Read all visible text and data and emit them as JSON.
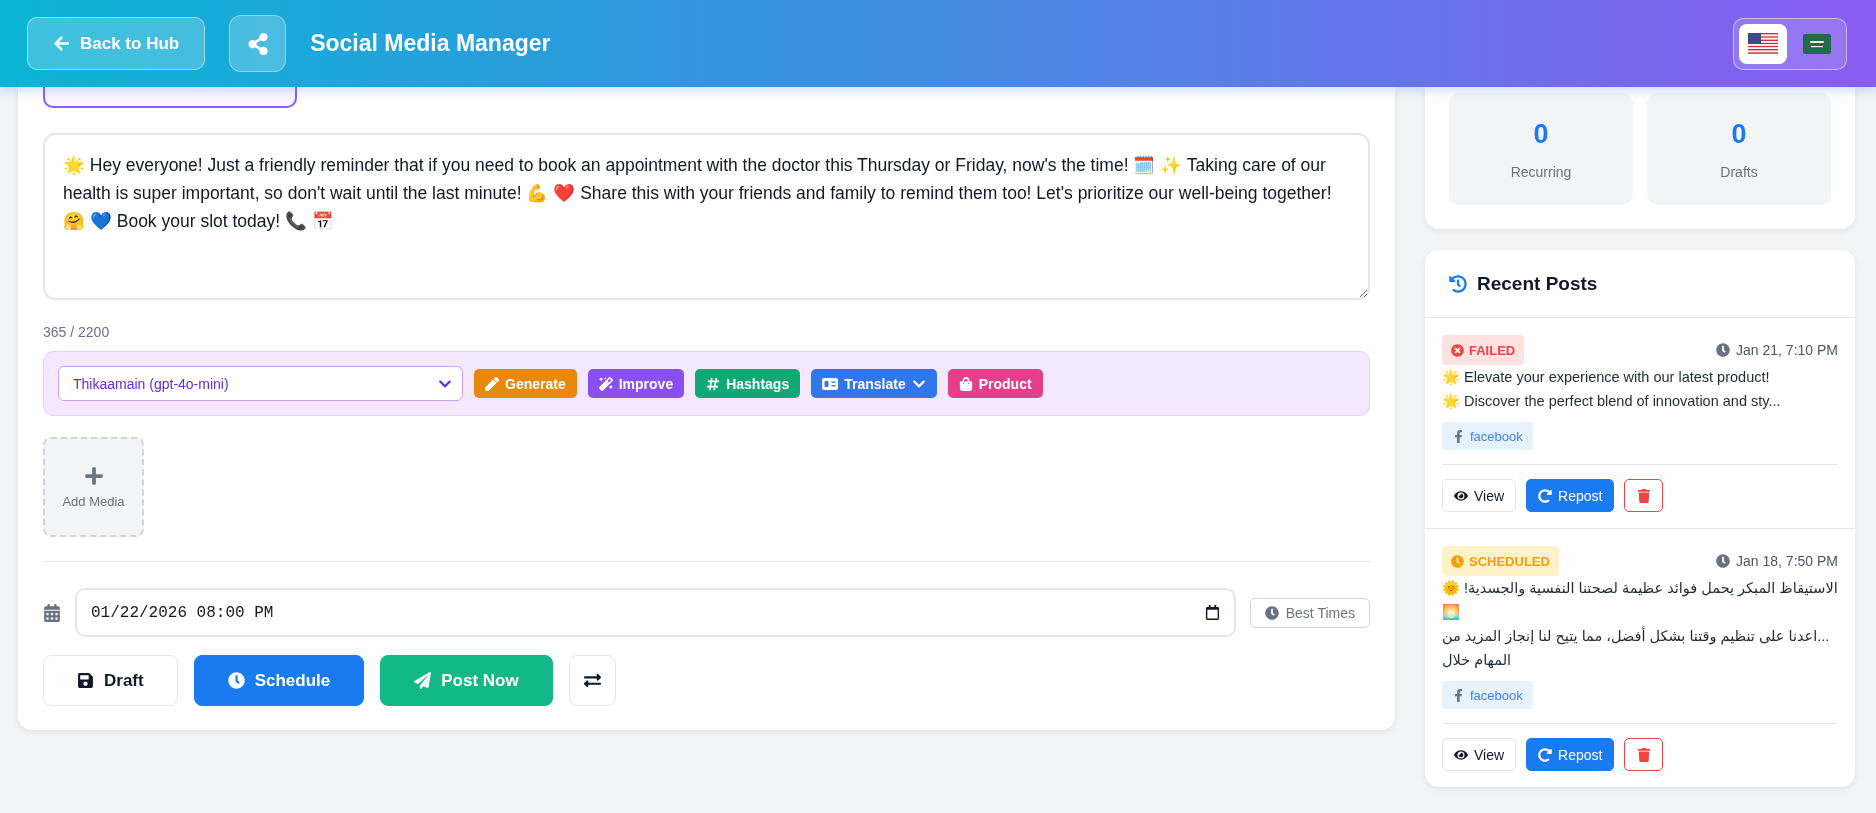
{
  "header": {
    "back_button": "Back to Hub",
    "title": "Social Media Manager",
    "languages": [
      {
        "kind": "us",
        "selected": true
      },
      {
        "kind": "sa",
        "selected": false
      }
    ]
  },
  "composer": {
    "content": "🌟 Hey everyone! Just a friendly reminder that if you need to book an appointment with the doctor this Thursday or Friday, now's the time! 🗓️ ✨ Taking care of our health is super important, so don't wait until the last minute! 💪 ❤️ Share this with your friends and family to remind them too! Let's prioritize our well-being together! 🤗 💙 Book your slot today! 📞 📅",
    "char_count": "365 / 2200",
    "ai_model": "Thikaamain (gpt-4o-mini)",
    "ai_actions": [
      {
        "kind": "generate",
        "label": "Generate",
        "color": "#e8890c"
      },
      {
        "kind": "improve",
        "label": "Improve",
        "color": "#8b4ff0"
      },
      {
        "kind": "hashtags",
        "label": "Hashtags",
        "color": "#10a874"
      },
      {
        "kind": "translate",
        "label": "Translate",
        "color": "#3176ea"
      },
      {
        "kind": "product",
        "label": "Product",
        "color": "#e53e8c"
      }
    ],
    "add_media": "Add Media",
    "schedule_value": "01/22/2026 08:00 PM",
    "best_times": "Best Times",
    "actions": [
      {
        "kind": "draft",
        "label": "Draft"
      },
      {
        "kind": "schedule",
        "label": "Schedule"
      },
      {
        "kind": "post",
        "label": "Post Now"
      },
      {
        "kind": "recurring"
      }
    ]
  },
  "stats": [
    {
      "value": "0",
      "label": "Recurring"
    },
    {
      "value": "0",
      "label": "Drafts"
    }
  ],
  "recent_posts": {
    "title": "Recent Posts",
    "posts": [
      {
        "kind": "failed",
        "status_label": "FAILED",
        "time": "Jan 21, 7:10 PM",
        "lines": [
          "🌟 Elevate your experience with our latest product!",
          "🌟 Discover the perfect blend of innovation and sty..."
        ],
        "platform": "facebook",
        "view": "View",
        "repost": "Repost"
      },
      {
        "kind": "scheduled",
        "status_label": "SCHEDULED",
        "time": "Jan 18, 7:50 PM",
        "lines": [
          "الاستيقاظ المبكر يحمل فوائد عظيمة لصحتنا النفسية والجسدية! 🌞 🌅",
          "...اعدنا على تنظيم وقتنا بشكل أفضل، مما يتيح لنا إنجاز المزيد من المهام خلال"
        ],
        "platform": "facebook",
        "view": "View",
        "repost": "Repost"
      }
    ]
  }
}
